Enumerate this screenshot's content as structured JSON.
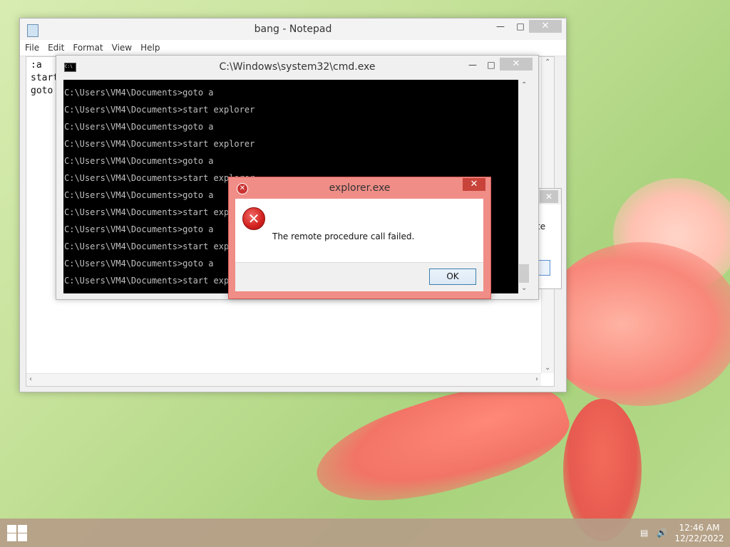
{
  "notepad": {
    "title": "bang - Notepad",
    "menu": [
      "File",
      "Edit",
      "Format",
      "View",
      "Help"
    ],
    "content": ":a\nstart\ngoto",
    "minimize_icon": "minimize-icon",
    "maximize_icon": "maximize-icon",
    "close_icon": "close-icon"
  },
  "cmd": {
    "title": "C:\\Windows\\system32\\cmd.exe",
    "lines": [
      "C:\\Users\\VM4\\Documents>goto a",
      "C:\\Users\\VM4\\Documents>start explorer",
      "C:\\Users\\VM4\\Documents>goto a",
      "C:\\Users\\VM4\\Documents>start explorer",
      "C:\\Users\\VM4\\Documents>goto a",
      "C:\\Users\\VM4\\Documents>start explorer",
      "C:\\Users\\VM4\\Documents>goto a",
      "C:\\Users\\VM4\\Documents>start explorer",
      "C:\\Users\\VM4\\Documents>goto a",
      "C:\\Users\\VM4\\Documents>start explorer",
      "C:\\Users\\VM4\\Documents>goto a",
      "C:\\Users\\VM4\\Documents>start explorer"
    ],
    "icon_label": "C:\\"
  },
  "error_dialog": {
    "title": "explorer.exe",
    "message": "The remote procedure call failed.",
    "ok_label": "OK",
    "icon": "error-icon",
    "close_glyph": "✕"
  },
  "background_dialog": {
    "fragment": "te",
    "close_glyph": "✕"
  },
  "taskbar": {
    "time": "12:46 AM",
    "date": "12/22/2022",
    "tray_icons": [
      "network-icon",
      "volume-icon"
    ]
  },
  "colors": {
    "error_frame": "#f08d87",
    "console_bg": "#000000",
    "taskbar": "#b59d88"
  }
}
